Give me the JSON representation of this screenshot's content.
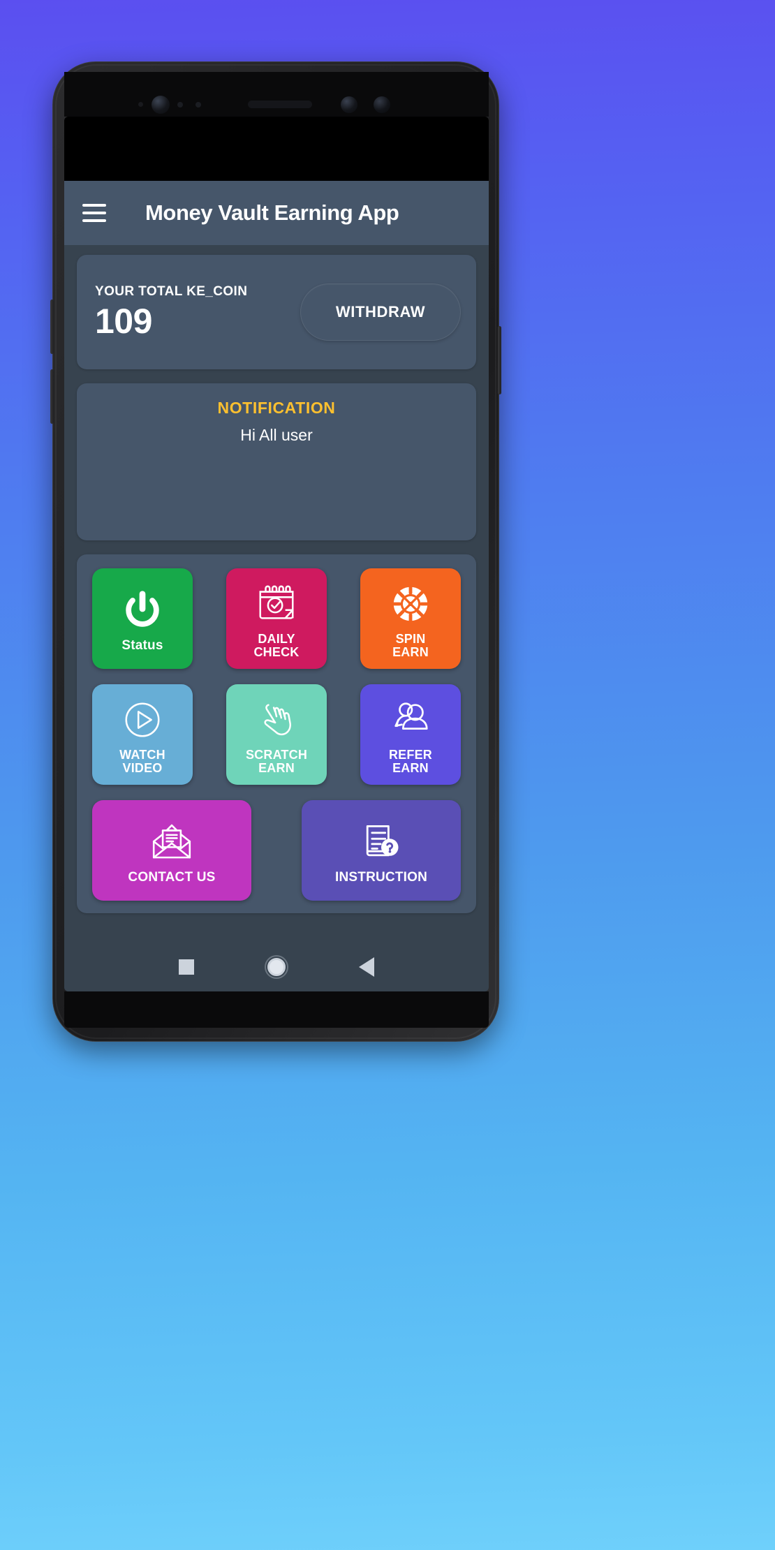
{
  "background": {
    "gradient_from": "#5b4ff0",
    "gradient_to": "#6fd0fb"
  },
  "theme": {
    "app_background": "#37434f",
    "card_background": "#46566a",
    "appbar_background": "#46566a",
    "accent_yellow": "#fdc02f",
    "text_white": "#ffffff"
  },
  "appbar": {
    "menu_icon": "hamburger-menu-icon",
    "title": "Money Vault Earning App"
  },
  "balance": {
    "label": "YOUR TOTAL KE_COIN",
    "value": "109",
    "withdraw_label": "WITHDRAW"
  },
  "notification": {
    "title": "NOTIFICATION",
    "message": "Hi All user"
  },
  "menu": {
    "rows": [
      [
        {
          "id": "status",
          "label": "Status",
          "icon": "power-icon",
          "color": "#17a94a",
          "label_lines": [
            "Status"
          ]
        },
        {
          "id": "daily-check",
          "label": "DAILY CHECK",
          "icon": "calendar-check-icon",
          "color": "#cf1a5f",
          "label_lines": [
            "DAILY",
            "CHECK"
          ]
        },
        {
          "id": "spin-earn",
          "label": "SPIN EARN",
          "icon": "spin-wheel-icon",
          "color": "#f4641f",
          "label_lines": [
            "SPIN",
            "EARN"
          ]
        }
      ],
      [
        {
          "id": "watch-video",
          "label": "WATCH VIDEO",
          "icon": "play-circle-icon",
          "color": "#67aed6",
          "label_lines": [
            "WATCH",
            "VIDEO"
          ]
        },
        {
          "id": "scratch-earn",
          "label": "SCRATCH EARN",
          "icon": "hand-tap-icon",
          "color": "#6fd4b9",
          "label_lines": [
            "SCRATCH",
            "EARN"
          ]
        },
        {
          "id": "refer-earn",
          "label": "REFER EARN",
          "icon": "two-users-icon",
          "color": "#5d4fe0",
          "label_lines": [
            "REFER",
            "EARN"
          ]
        }
      ],
      [
        {
          "id": "contact-us",
          "label": "CONTACT US",
          "icon": "open-envelope-icon",
          "color": "#bf35bf",
          "label_lines": [
            "CONTACT US"
          ]
        },
        {
          "id": "instruction",
          "label": "INSTRUCTION",
          "icon": "document-question-icon",
          "color": "#5a4fb5",
          "label_lines": [
            "INSTRUCTION"
          ]
        }
      ]
    ]
  },
  "navbar": {
    "recents_icon": "square-recents-icon",
    "home_icon": "circle-home-icon",
    "back_icon": "triangle-back-icon"
  }
}
